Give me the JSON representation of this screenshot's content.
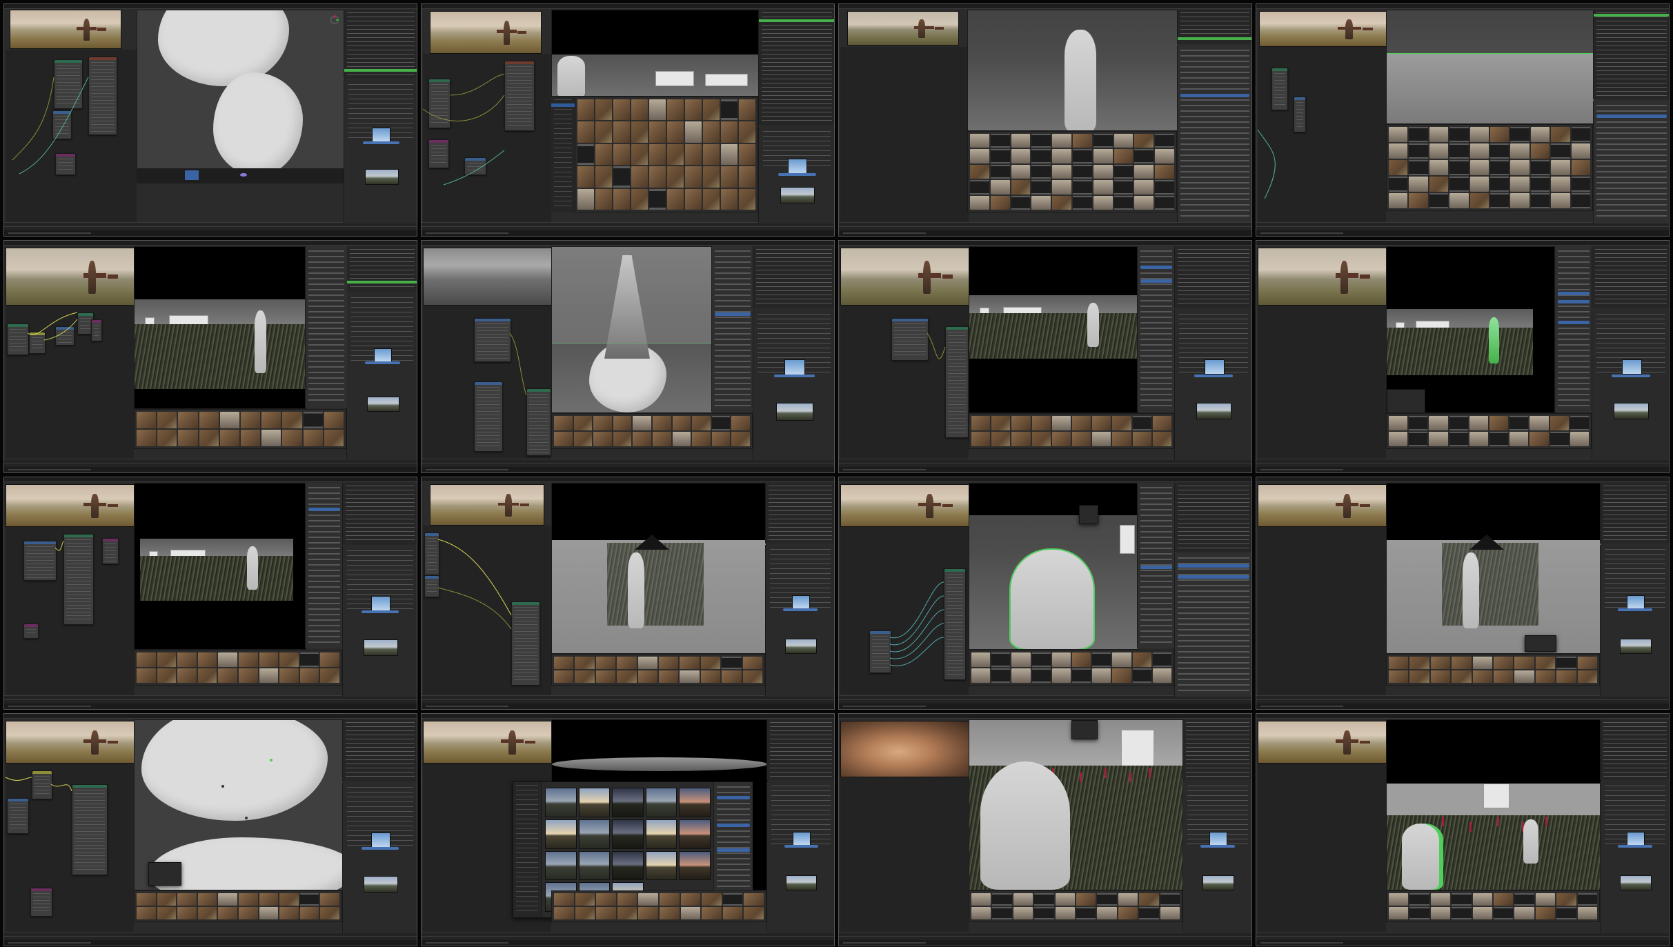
{
  "layout": {
    "rows": 4,
    "columns": 4,
    "panel_count": 16
  },
  "app": {
    "name": ""
  },
  "colors": {
    "app_background": "#2b2b2b",
    "selection_blue": "#4772b3",
    "outliner_active_green": "#46b14a",
    "gutter": "#060606"
  },
  "panels": [
    {
      "id": 1,
      "main_view": "viewport-sculpt-shape",
      "has_reference_image": true,
      "has_node_editor": true,
      "has_asset_browser": false
    },
    {
      "id": 2,
      "main_view": "viewport-buildings",
      "has_reference_image": true,
      "has_node_editor": true,
      "has_asset_browser": true
    },
    {
      "id": 3,
      "main_view": "viewport-character",
      "has_reference_image": true,
      "has_node_editor": false,
      "has_asset_browser": true
    },
    {
      "id": 4,
      "main_view": "viewport-terrain",
      "has_reference_image": true,
      "has_node_editor": true,
      "has_asset_browser": true
    },
    {
      "id": 5,
      "main_view": "render-preview-field",
      "has_reference_image": true,
      "has_node_editor": true,
      "has_asset_browser": true
    },
    {
      "id": 6,
      "main_view": "viewport-scatter-cone",
      "has_reference_image": true,
      "has_node_editor": true,
      "has_asset_browser": true
    },
    {
      "id": 7,
      "main_view": "render-preview-field",
      "has_reference_image": true,
      "has_node_editor": true,
      "has_asset_browser": true
    },
    {
      "id": 8,
      "main_view": "render-preview-field-selected",
      "has_reference_image": true,
      "has_node_editor": false,
      "has_asset_browser": true
    },
    {
      "id": 9,
      "main_view": "render-preview-field",
      "has_reference_image": true,
      "has_node_editor": true,
      "has_asset_browser": true
    },
    {
      "id": 10,
      "main_view": "viewport-character-grass",
      "has_reference_image": true,
      "has_node_editor": true,
      "has_asset_browser": true
    },
    {
      "id": 11,
      "main_view": "viewport-bust",
      "has_reference_image": true,
      "has_node_editor": true,
      "has_asset_browser": true
    },
    {
      "id": 12,
      "main_view": "viewport-character-grass",
      "has_reference_image": true,
      "has_node_editor": false,
      "has_asset_browser": true
    },
    {
      "id": 13,
      "main_view": "viewport-sculpt-shape",
      "has_reference_image": true,
      "has_node_editor": true,
      "has_asset_browser": true
    },
    {
      "id": 14,
      "main_view": "hdri-browser-popup",
      "has_reference_image": true,
      "has_node_editor": false,
      "has_asset_browser": true
    },
    {
      "id": 15,
      "main_view": "render-bust-closeup",
      "has_reference_image": true,
      "has_node_editor": false,
      "has_asset_browser": true
    },
    {
      "id": 16,
      "main_view": "render-bust-field",
      "has_reference_image": true,
      "has_node_editor": false,
      "has_asset_browser": true
    }
  ]
}
